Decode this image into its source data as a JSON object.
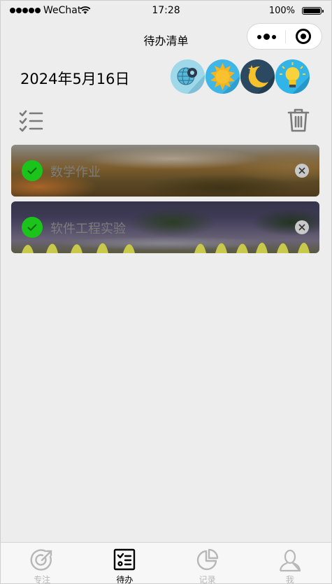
{
  "status_bar": {
    "carrier": "WeChat",
    "time": "17:28",
    "battery": "100%"
  },
  "nav": {
    "title": "待办清单"
  },
  "header": {
    "date": "2024年5月16日",
    "weather_icons": [
      "globe-gear-icon",
      "sun-icon",
      "moon-night-icon",
      "lightbulb-icon"
    ]
  },
  "toolbar": {
    "left_icon": "checklist-icon",
    "right_icon": "trash-icon"
  },
  "todos": [
    {
      "label": "数学作业",
      "done": true
    },
    {
      "label": "软件工程实验",
      "done": true
    }
  ],
  "tabbar": {
    "items": [
      {
        "label": "专注",
        "icon": "focus-target-icon",
        "active": false
      },
      {
        "label": "待办",
        "icon": "todo-list-icon",
        "active": true
      },
      {
        "label": "记录",
        "icon": "pie-chart-icon",
        "active": false
      },
      {
        "label": "我",
        "icon": "user-icon",
        "active": false
      }
    ]
  },
  "colors": {
    "check": "#1bc41b",
    "background": "#ededed",
    "inactive_tab": "#b7b7b7"
  }
}
